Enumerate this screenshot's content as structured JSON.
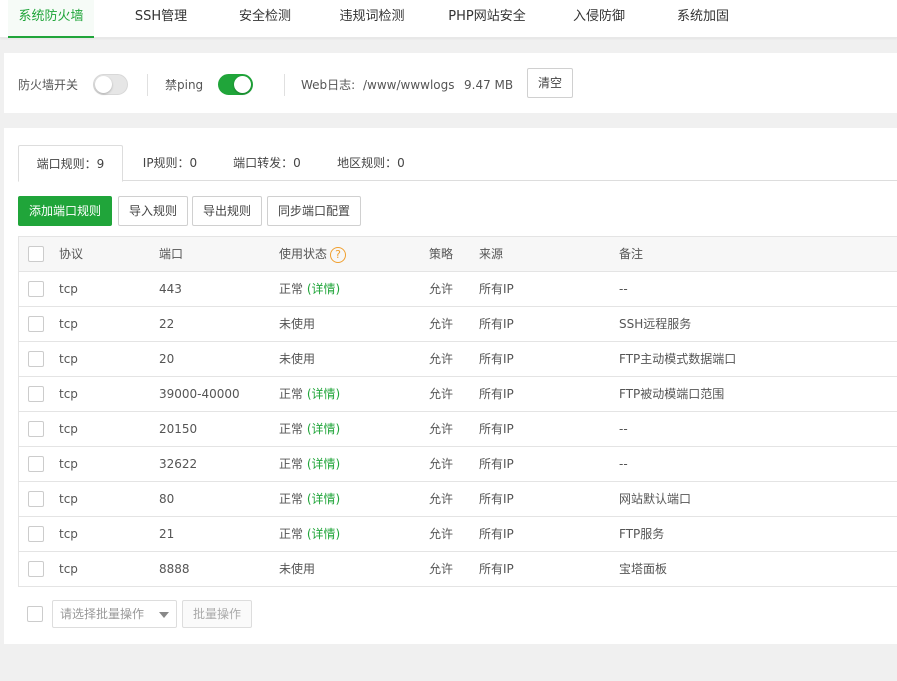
{
  "topnav": {
    "tabs": [
      {
        "label": "系统防火墙",
        "active": true
      },
      {
        "label": "SSH管理"
      },
      {
        "label": "安全检测"
      },
      {
        "label": "违规词检测"
      },
      {
        "label": "PHP网站安全"
      },
      {
        "label": "入侵防御"
      },
      {
        "label": "系统加固"
      }
    ]
  },
  "fwbar": {
    "firewall_label": "防火墙开关",
    "firewall_on": false,
    "ping_label": "禁ping",
    "ping_on": true,
    "weblog_label": "Web日志:",
    "weblog_path": "/www/wwwlogs",
    "weblog_size": "9.47 MB",
    "clear_label": "清空"
  },
  "tabs": [
    {
      "label": "端口规则：9",
      "active": true
    },
    {
      "label": "IP规则：0"
    },
    {
      "label": "端口转发：0"
    },
    {
      "label": "地区规则：0"
    }
  ],
  "toolbar": {
    "add": "添加端口规则",
    "import": "导入规则",
    "export": "导出规则",
    "sync": "同步端口配置"
  },
  "table": {
    "headers": {
      "protocol": "协议",
      "port": "端口",
      "status": "使用状态",
      "status_help": "?",
      "policy": "策略",
      "source": "来源",
      "remark": "备注"
    },
    "rows": [
      {
        "protocol": "tcp",
        "port": "443",
        "status": "正常",
        "detail": "(详情)",
        "policy": "允许",
        "source": "所有IP",
        "remark": "--"
      },
      {
        "protocol": "tcp",
        "port": "22",
        "status": "未使用",
        "detail": "",
        "policy": "允许",
        "source": "所有IP",
        "remark": "SSH远程服务"
      },
      {
        "protocol": "tcp",
        "port": "20",
        "status": "未使用",
        "detail": "",
        "policy": "允许",
        "source": "所有IP",
        "remark": "FTP主动模式数据端口"
      },
      {
        "protocol": "tcp",
        "port": "39000-40000",
        "status": "正常",
        "detail": "(详情)",
        "policy": "允许",
        "source": "所有IP",
        "remark": "FTP被动模端口范围"
      },
      {
        "protocol": "tcp",
        "port": "20150",
        "status": "正常",
        "detail": "(详情)",
        "policy": "允许",
        "source": "所有IP",
        "remark": "--"
      },
      {
        "protocol": "tcp",
        "port": "32622",
        "status": "正常",
        "detail": "(详情)",
        "policy": "允许",
        "source": "所有IP",
        "remark": "--"
      },
      {
        "protocol": "tcp",
        "port": "80",
        "status": "正常",
        "detail": "(详情)",
        "policy": "允许",
        "source": "所有IP",
        "remark": "网站默认端口"
      },
      {
        "protocol": "tcp",
        "port": "21",
        "status": "正常",
        "detail": "(详情)",
        "policy": "允许",
        "source": "所有IP",
        "remark": "FTP服务"
      },
      {
        "protocol": "tcp",
        "port": "8888",
        "status": "未使用",
        "detail": "",
        "policy": "允许",
        "source": "所有IP",
        "remark": "宝塔面板"
      }
    ]
  },
  "footer": {
    "batch_placeholder": "请选择批量操作",
    "batch_button": "批量操作"
  },
  "colors": {
    "accent": "#20a53a",
    "help_icon": "#f0a030"
  }
}
